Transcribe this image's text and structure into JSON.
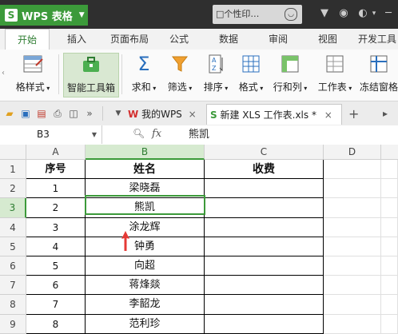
{
  "titlebar": {
    "app_name": "WPS 表格",
    "app_logo": "S",
    "search_label": "□个性印…"
  },
  "menu": {
    "tabs": [
      "开始",
      "插入",
      "页面布局",
      "公式",
      "数据",
      "审阅",
      "视图",
      "开发工具"
    ]
  },
  "ribbon": {
    "format_styles": "格样式",
    "smart_toolbox": "智能工具箱",
    "sum": "求和",
    "filter": "筛选",
    "sort": "排序",
    "format": "格式",
    "row_col": "行和列",
    "sheet": "工作表",
    "freeze": "冻结窗格"
  },
  "quickbar": {
    "doc1": "我的WPS",
    "doc2": "新建 XLS 工作表.xls *",
    "new_tab": "+"
  },
  "formula_bar": {
    "cell_ref": "B3",
    "fx": "fx",
    "value": "熊凯"
  },
  "sheet": {
    "columns": [
      "A",
      "B",
      "C",
      "D"
    ],
    "rows": [
      "1",
      "2",
      "3",
      "4",
      "5",
      "6",
      "7",
      "8",
      "9"
    ],
    "cells": [
      [
        "序号",
        "姓名",
        "收费"
      ],
      [
        "1",
        "梁晓磊",
        ""
      ],
      [
        "2",
        "熊凯",
        ""
      ],
      [
        "3",
        "涂龙辉",
        ""
      ],
      [
        "4",
        "钟勇",
        ""
      ],
      [
        "5",
        "向超",
        ""
      ],
      [
        "6",
        "蒋烽燚",
        ""
      ],
      [
        "7",
        "李韶龙",
        ""
      ],
      [
        "8",
        "范利珍",
        ""
      ]
    ]
  },
  "colors": {
    "accent": "#3c9a3a",
    "titlebar": "#2f2f2f",
    "selection": "#3c9a3a",
    "cursor_arrow": "#e53935"
  }
}
